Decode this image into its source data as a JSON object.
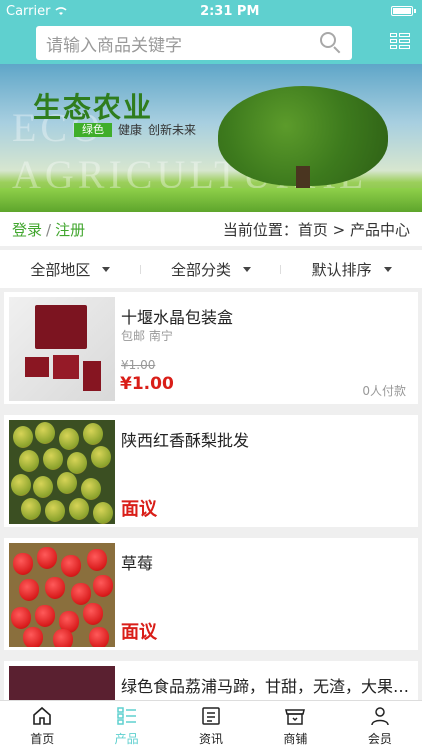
{
  "status": {
    "carrier": "Carrier",
    "time": "2:31 PM"
  },
  "search": {
    "placeholder": "请输入商品关键字"
  },
  "banner": {
    "title": "生态农业",
    "tag": "绿色",
    "slogan_1": "健康",
    "slogan_2": "创新未来",
    "watermark": "ECO AGRICULTURAL"
  },
  "location": {
    "login": "登录",
    "separator": "/",
    "register": "注册",
    "breadcrumb": "当前位置：首页 > 产品中心"
  },
  "filters": [
    {
      "label": "全部地区"
    },
    {
      "label": "全部分类"
    },
    {
      "label": "默认排序"
    }
  ],
  "products": [
    {
      "name": "十堰水晶包装盒",
      "meta": "包邮 南宁",
      "old_price": "¥1.00",
      "price": "¥1.00",
      "sales": "0人付款"
    },
    {
      "name": "陕西红香酥梨批发",
      "price_label": "面议"
    },
    {
      "name": "草莓",
      "price_label": "面议"
    },
    {
      "name": "绿色食品荔浦马蹄，甘甜，无渣，大果，..."
    }
  ],
  "tabs": [
    {
      "label": "首页",
      "icon": "home-icon"
    },
    {
      "label": "产品",
      "icon": "list-icon"
    },
    {
      "label": "资讯",
      "icon": "news-icon"
    },
    {
      "label": "商铺",
      "icon": "store-icon"
    },
    {
      "label": "会员",
      "icon": "user-icon"
    }
  ],
  "colors": {
    "accent": "#5fd0cf",
    "green": "#41a62e",
    "price_red": "#d91e18"
  }
}
